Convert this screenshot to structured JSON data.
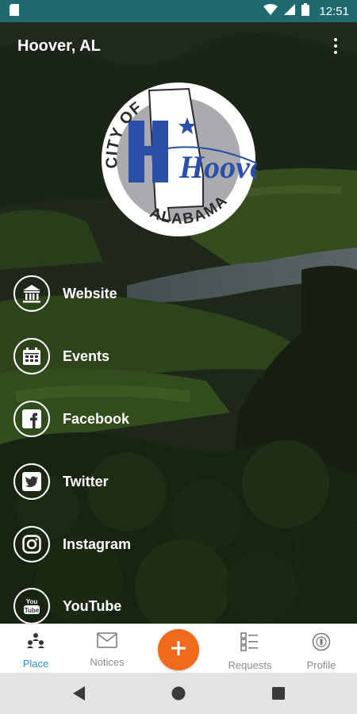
{
  "status_bar": {
    "time": "12:51"
  },
  "header": {
    "title": "Hoover, AL",
    "menu_icon": "more-vert-icon"
  },
  "seal": {
    "top_text": "CITY OF",
    "name": "Hoover",
    "bottom_text": "ALABAMA"
  },
  "links": [
    {
      "label": "Website",
      "icon": "bank-icon"
    },
    {
      "label": "Events",
      "icon": "calendar-icon"
    },
    {
      "label": "Facebook",
      "icon": "facebook-icon"
    },
    {
      "label": "Twitter",
      "icon": "twitter-icon"
    },
    {
      "label": "Instagram",
      "icon": "instagram-icon"
    },
    {
      "label": "YouTube",
      "icon": "youtube-icon"
    }
  ],
  "bottom_nav": {
    "items": [
      {
        "label": "Place",
        "icon": "place-people-icon",
        "active": true
      },
      {
        "label": "Notices",
        "icon": "envelope-icon",
        "active": false
      },
      {
        "label": "Requests",
        "icon": "checklist-icon",
        "active": false
      },
      {
        "label": "Profile",
        "icon": "profile-icon",
        "active": false
      }
    ],
    "fab_icon": "plus-icon"
  },
  "colors": {
    "status_bar": "#1f6a70",
    "accent": "#f06a1b",
    "active_nav": "#2a8fd6",
    "seal_blue": "#2a4fa8"
  }
}
